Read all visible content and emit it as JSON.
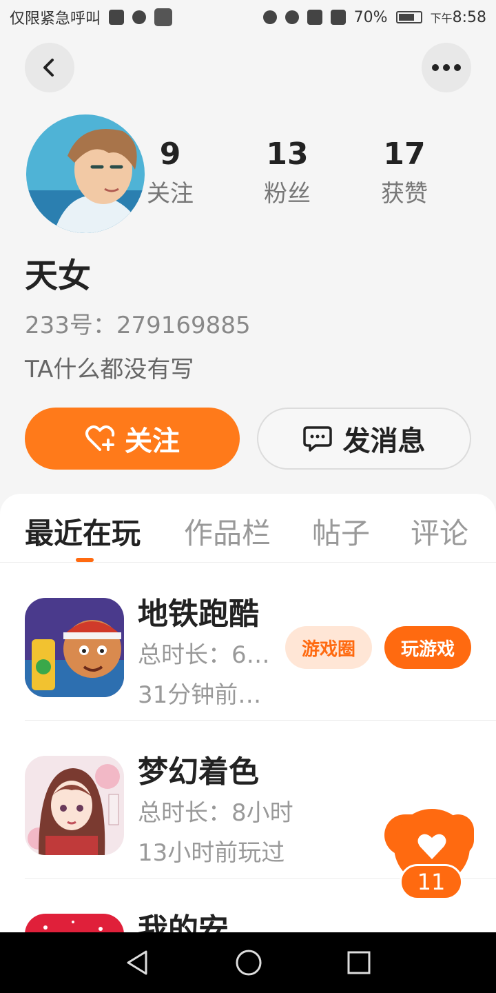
{
  "status_bar": {
    "carrier": "仅限紧急呼叫",
    "battery": "70%",
    "time_prefix": "下午",
    "time": "8:58"
  },
  "profile": {
    "username": "天女",
    "id_text": "233号：279169885",
    "bio": "TA什么都没有写",
    "stats": [
      {
        "value": "9",
        "label": "关注"
      },
      {
        "value": "13",
        "label": "粉丝"
      },
      {
        "value": "17",
        "label": "获赞"
      }
    ],
    "follow_label": "关注",
    "message_label": "发消息"
  },
  "tabs": [
    "最近在玩",
    "作品栏",
    "帖子",
    "评论"
  ],
  "active_tab_index": 0,
  "games": [
    {
      "name": "地铁跑酷",
      "duration": "总时长：6…",
      "last_played": "31分钟前…",
      "circle_label": "游戏圈",
      "play_label": "玩游戏"
    },
    {
      "name": "梦幻着色",
      "duration": "总时长：8小时",
      "last_played": "13小时前玩过"
    },
    {
      "name": "我的安…"
    }
  ],
  "like_badge": {
    "count": "11"
  },
  "colors": {
    "accent": "#ff7a1a",
    "accent_light": "#ffe6d6",
    "background": "#f5f5f5"
  },
  "icons": {
    "back": "chevron-left-icon",
    "more": "more-dots-icon",
    "follow": "heart-plus-icon",
    "message": "chat-bubble-icon",
    "like": "heart-icon",
    "nav_back": "triangle-back-icon",
    "nav_home": "circle-home-icon",
    "nav_recent": "square-recent-icon"
  }
}
